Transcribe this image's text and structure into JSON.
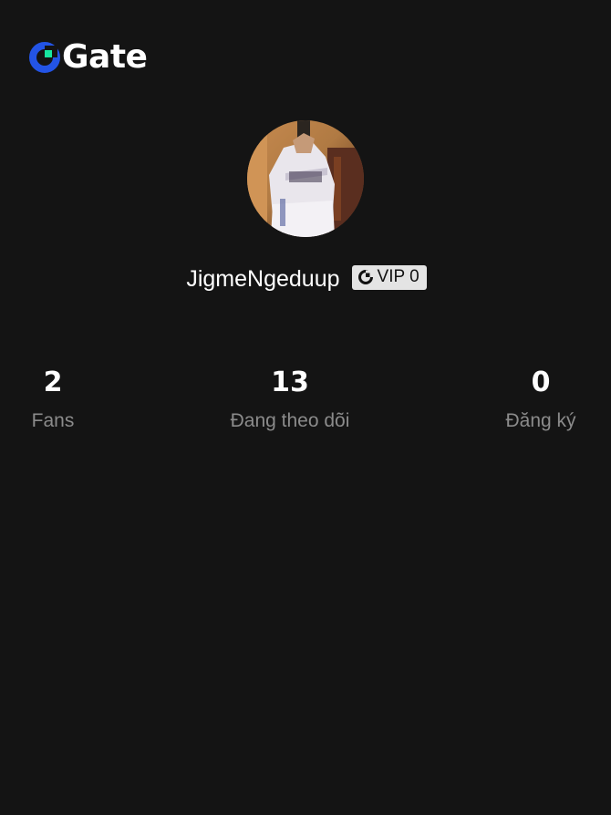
{
  "brand": {
    "name": "Gate",
    "mark_icon": "gate-logo-icon",
    "mark_colors": {
      "primary": "#2354E6",
      "accent": "#17E6A1"
    }
  },
  "profile": {
    "avatar_icon": "user-avatar",
    "username": "JigmeNgeduup",
    "vip": {
      "icon": "gate-mini-icon",
      "label": "VIP 0"
    }
  },
  "stats": [
    {
      "value": "2",
      "label": "Fans"
    },
    {
      "value": "13",
      "label": "Đang theo dõi"
    },
    {
      "value": "0",
      "label": "Đăng ký"
    }
  ],
  "colors": {
    "background": "#141414",
    "text": "#ffffff",
    "muted": "#8b8b8b",
    "badge_bg": "#e4e4e4"
  }
}
